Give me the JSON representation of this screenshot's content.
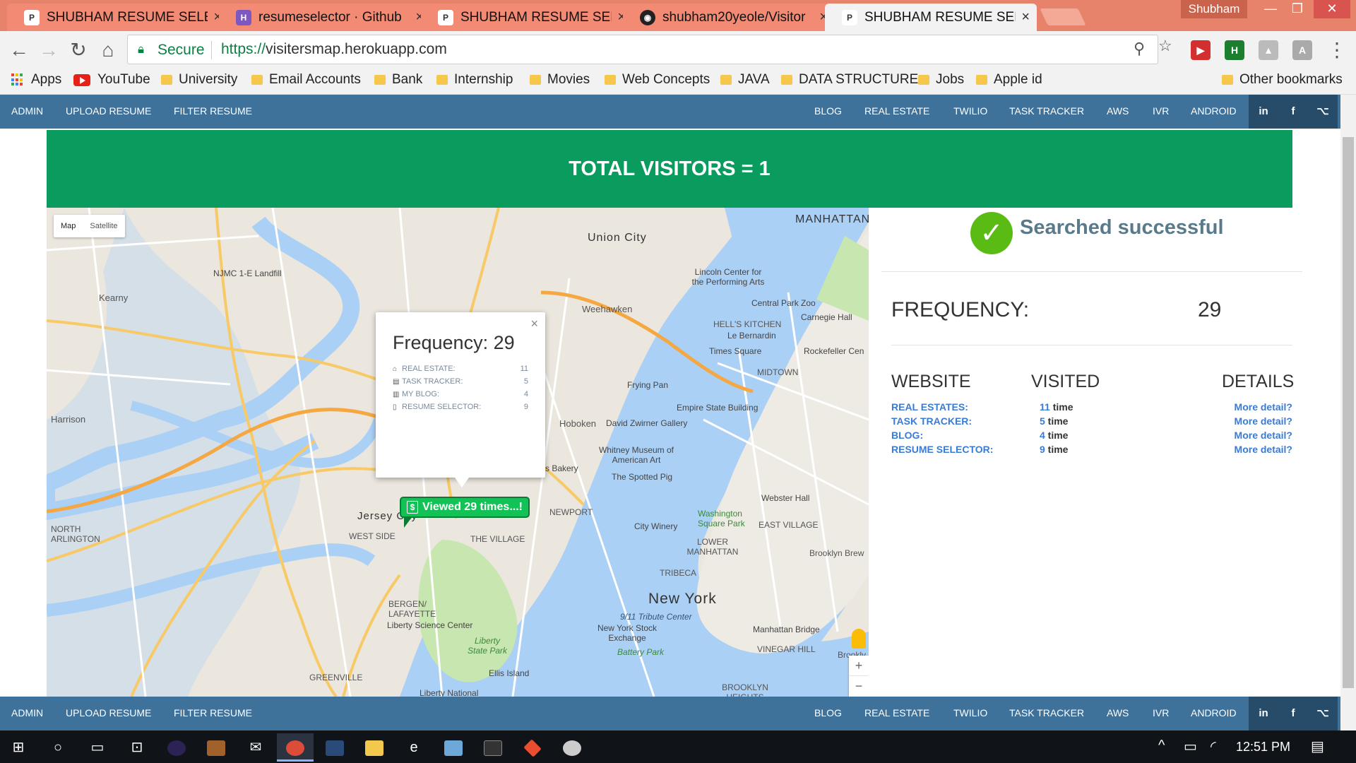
{
  "browser": {
    "tabs": [
      {
        "label": "SHUBHAM RESUME SELE",
        "favicon": "pace-icon",
        "active": false
      },
      {
        "label": "resumeselector · Github",
        "favicon": "heroku-icon",
        "active": false
      },
      {
        "label": "SHUBHAM RESUME SELE",
        "favicon": "pace-icon",
        "active": false
      },
      {
        "label": "shubham20yeole/Visitor",
        "favicon": "github-icon",
        "active": false
      },
      {
        "label": "SHUBHAM RESUME SELE",
        "favicon": "pace-icon",
        "active": true
      }
    ],
    "user": "Shubham",
    "secure_label": "Secure",
    "url_proto": "https://",
    "url_host": "visitersmap.herokuapp.com",
    "bookmarks": [
      "Apps",
      "YouTube",
      "University",
      "Email Accounts",
      "Bank",
      "Internship",
      "Movies",
      "Web Concepts",
      "JAVA",
      "DATA STRUCTURE",
      "Jobs",
      "Apple id"
    ],
    "other_bookmarks": "Other bookmarks"
  },
  "nav": {
    "left": [
      "ADMIN",
      "UPLOAD RESUME",
      "FILTER RESUME"
    ],
    "right": [
      "BLOG",
      "REAL ESTATE",
      "TWILIO",
      "TASK TRACKER",
      "AWS",
      "IVR",
      "ANDROID"
    ],
    "social": [
      "in",
      "f",
      "⌥"
    ]
  },
  "banner": "TOTAL VISITORS = 1",
  "map": {
    "type_buttons": [
      "Map",
      "Satellite"
    ],
    "infowindow": {
      "title": "Frequency: 29",
      "rows": [
        {
          "name": "REAL ESTATE:",
          "value": "11"
        },
        {
          "name": "TASK TRACKER:",
          "value": "5"
        },
        {
          "name": "MY BLOG:",
          "value": "4"
        },
        {
          "name": "RESUME SELECTOR:",
          "value": "9"
        }
      ]
    },
    "marker": "Viewed 29 times...!",
    "marker_symbol": "$",
    "labels": {
      "manhattan": "MANHATTAN",
      "union_city": "Union City",
      "njmc": "NJMC 1-E Landfill",
      "kearny": "Kearny",
      "harrison": "Harrison",
      "weehawken": "Weehawken",
      "lincoln": "Lincoln Center for the Performing Arts",
      "central_zoo": "Central Park Zoo",
      "carnegie": "Carnegie Hall",
      "hells_kitchen": "HELL'S KITCHEN",
      "bernardin": "Le Bernardin",
      "times_sq": "Times Square",
      "rockefeller": "Rockefeller Cen",
      "midtown": "MIDTOWN",
      "frying_pan": "Frying Pan",
      "esb": "Empire State Building",
      "hoboken": "Hoboken",
      "zwirner": "David Zwirner Gallery",
      "whitney": "Whitney Museum of American Art",
      "bakery": "s Bakery",
      "spotted_pig": "The Spotted Pig",
      "webster": "Webster Hall",
      "jersey_city": "Jersey City",
      "west_side": "WEST SIDE",
      "the_village": "THE VILLAGE",
      "newport": "NEWPORT",
      "city_winery": "City Winery",
      "washington_sq": "Washington Square Park",
      "east_village": "EAST VILLAGE",
      "lower_manhattan": "LOWER MANHATTAN",
      "tribeca": "TRIBECA",
      "new_york": "New York",
      "tribute": "9/11 Tribute Center",
      "nyse": "New York Stock Exchange",
      "battery": "Battery Park",
      "manhattan_bridge": "Manhattan Bridge",
      "vinegar_hill": "VINEGAR HILL",
      "bergen": "BERGEN/ LAFAYETTE",
      "liberty_sci": "Liberty Science Center",
      "liberty_park": "Liberty State Park",
      "ellis": "Ellis Island",
      "greenville": "GREENVILLE",
      "liberty_natl": "Liberty National",
      "north_arlington": "NORTH ARLINGTON",
      "brooklyn_heights": "BROOKLYN HEIGHTS",
      "brooklyn_brew": "Brooklyn Brew",
      "dumbo": "Brookly"
    }
  },
  "panel": {
    "success": "Searched successful",
    "frequency_label": "FREQUENCY:",
    "frequency_value": "29",
    "headers": [
      "WEBSITE",
      "VISITED",
      "DETAILS"
    ],
    "rows": [
      {
        "site": "REAL ESTATES:",
        "count": "11",
        "unit": " time",
        "link": "More detail?"
      },
      {
        "site": "TASK TRACKER:",
        "count": "5",
        "unit": " time",
        "link": "More detail?"
      },
      {
        "site": "BLOG:",
        "count": "4",
        "unit": " time",
        "link": "More detail?"
      },
      {
        "site": "RESUME SELECTOR:",
        "count": "9",
        "unit": " time",
        "link": "More detail?"
      }
    ]
  },
  "taskbar": {
    "time": "12:51 PM"
  },
  "colors": {
    "nav": "#3f729b",
    "banner": "#0a9b5e",
    "link": "#3a7bd5",
    "success_check": "#5bbb15"
  }
}
